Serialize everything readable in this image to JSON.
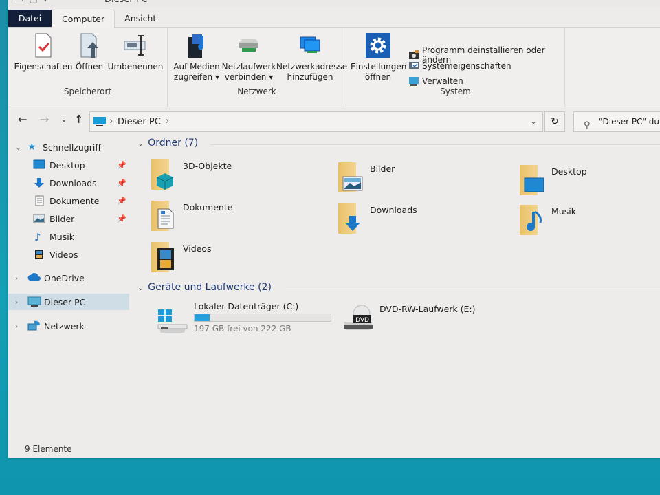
{
  "window": {
    "title": "Dieser PC",
    "tabs": [
      {
        "label": "Datei"
      },
      {
        "label": "Computer"
      },
      {
        "label": "Ansicht"
      }
    ],
    "active_tab": "Computer"
  },
  "ribbon": {
    "groups": [
      {
        "label": "Speicherort",
        "buttons": [
          {
            "label": "Eigenschaften",
            "icon": "properties-icon"
          },
          {
            "label": "Öffnen",
            "icon": "open-icon"
          },
          {
            "label": "Umbenennen",
            "icon": "rename-icon"
          }
        ]
      },
      {
        "label": "Netzwerk",
        "buttons": [
          {
            "label_line1": "Auf Medien",
            "label_line2": "zugreifen",
            "icon": "media-server-icon",
            "dropdown": true
          },
          {
            "label_line1": "Netzlaufwerk",
            "label_line2": "verbinden",
            "icon": "network-drive-icon",
            "dropdown": true
          },
          {
            "label_line1": "Netzwerkadresse",
            "label_line2": "hinzufügen",
            "icon": "network-location-icon"
          }
        ]
      },
      {
        "label": "System",
        "buttons": [
          {
            "label_line1": "Einstellungen",
            "label_line2": "öffnen",
            "icon": "settings-gear-icon"
          }
        ],
        "small_buttons": [
          {
            "label": "Programm deinstallieren oder ändern",
            "icon": "uninstall-program-icon"
          },
          {
            "label": "Systemeigenschaften",
            "icon": "system-properties-icon"
          },
          {
            "label": "Verwalten",
            "icon": "manage-icon"
          }
        ]
      }
    ]
  },
  "navigation": {
    "back": "←",
    "forward": "→",
    "recent": "⌄",
    "up": "↑",
    "breadcrumb": [
      "Dieser PC"
    ],
    "search_placeholder": "\"Dieser PC\" durchsuchen"
  },
  "sidebar": {
    "quick_access": {
      "label": "Schnellzugriff",
      "items": [
        {
          "label": "Desktop",
          "pinned": true
        },
        {
          "label": "Downloads",
          "pinned": true
        },
        {
          "label": "Dokumente",
          "pinned": true
        },
        {
          "label": "Bilder",
          "pinned": true
        },
        {
          "label": "Musik",
          "pinned": false
        },
        {
          "label": "Videos",
          "pinned": false
        }
      ]
    },
    "roots": [
      {
        "label": "OneDrive"
      },
      {
        "label": "Dieser PC",
        "selected": true
      },
      {
        "label": "Netzwerk"
      }
    ]
  },
  "content": {
    "folders_header": "Ordner (7)",
    "folders": [
      {
        "label": "3D-Objekte"
      },
      {
        "label": "Bilder"
      },
      {
        "label": "Desktop"
      },
      {
        "label": "Dokumente"
      },
      {
        "label": "Downloads"
      },
      {
        "label": "Musik"
      },
      {
        "label": "Videos"
      }
    ],
    "drives_header": "Geräte und Laufwerke (2)",
    "drives": [
      {
        "label": "Lokaler Datenträger (C:)",
        "free_text": "197 GB frei von 222 GB",
        "used_fraction": 0.113
      },
      {
        "label": "DVD-RW-Laufwerk (E:)",
        "badge": "DVD"
      }
    ]
  },
  "status": {
    "items_count": "9 Elemente"
  },
  "colors": {
    "accent": "#26a0da",
    "file_tab": "#14203a",
    "section_header": "#1f3a75",
    "folder": "#e9c16b",
    "desktop_bg": "#1599b1"
  }
}
